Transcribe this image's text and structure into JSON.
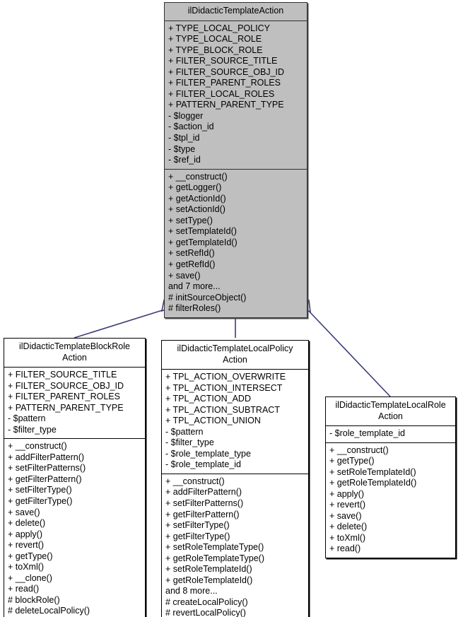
{
  "diagram": {
    "type": "uml-class-inheritance",
    "relationship": "generalization",
    "edge_color": "#3b3b7a"
  },
  "classes": {
    "base": {
      "name": "ilDidacticTemplateAction",
      "title_lines": "ilDidacticTemplateAction",
      "attributes": [
        "+ TYPE_LOCAL_POLICY",
        "+ TYPE_LOCAL_ROLE",
        "+ TYPE_BLOCK_ROLE",
        "+ FILTER_SOURCE_TITLE",
        "+ FILTER_SOURCE_OBJ_ID",
        "+ FILTER_PARENT_ROLES",
        "+ FILTER_LOCAL_ROLES",
        "+ PATTERN_PARENT_TYPE",
        "- $logger",
        "- $action_id",
        "- $tpl_id",
        "- $type",
        "- $ref_id"
      ],
      "operations": [
        "+ __construct()",
        "+ getLogger()",
        "+ getActionId()",
        "+ setActionId()",
        "+ setType()",
        "+ setTemplateId()",
        "+ getTemplateId()",
        "+ setRefId()",
        "+ getRefId()",
        "+ save()",
        "and 7 more...",
        "# initSourceObject()",
        "# filterRoles()"
      ]
    },
    "block_role": {
      "name": "ilDidacticTemplateBlockRoleAction",
      "title_lines": "ilDidacticTemplateBlockRole\nAction",
      "attributes": [
        "+ FILTER_SOURCE_TITLE",
        "+ FILTER_SOURCE_OBJ_ID",
        "+ FILTER_PARENT_ROLES",
        "+ PATTERN_PARENT_TYPE",
        "- $pattern",
        "- $filter_type"
      ],
      "operations": [
        "+ __construct()",
        "+ addFilterPattern()",
        "+ setFilterPatterns()",
        "+ getFilterPattern()",
        "+ setFilterType()",
        "+ getFilterType()",
        "+ save()",
        "+ delete()",
        "+ apply()",
        "+ revert()",
        "+ getType()",
        "+ toXml()",
        "+ __clone()",
        "+ read()",
        "# blockRole()",
        "# deleteLocalPolicy()"
      ]
    },
    "local_policy": {
      "name": "ilDidacticTemplateLocalPolicyAction",
      "title_lines": "ilDidacticTemplateLocalPolicy\nAction",
      "attributes": [
        "+ TPL_ACTION_OVERWRITE",
        "+ TPL_ACTION_INTERSECT",
        "+ TPL_ACTION_ADD",
        "+ TPL_ACTION_SUBTRACT",
        "+ TPL_ACTION_UNION",
        "- $pattern",
        "- $filter_type",
        "- $role_template_type",
        "- $role_template_id"
      ],
      "operations": [
        "+ __construct()",
        "+ addFilterPattern()",
        "+ setFilterPatterns()",
        "+ getFilterPattern()",
        "+ setFilterType()",
        "+ getFilterType()",
        "+ setRoleTemplateType()",
        "+ getRoleTemplateType()",
        "+ setRoleTemplateId()",
        "+ getRoleTemplateId()",
        "and 8 more...",
        "# createLocalPolicy()",
        "# revertLocalPolicy()"
      ]
    },
    "local_role": {
      "name": "ilDidacticTemplateLocalRoleAction",
      "title_lines": "ilDidacticTemplateLocalRole\nAction",
      "attributes": [
        "- $role_template_id"
      ],
      "operations": [
        "+ __construct()",
        "+ getType()",
        "+ setRoleTemplateId()",
        "+ getRoleTemplateId()",
        "+ apply()",
        "+ revert()",
        "+ save()",
        "+ delete()",
        "+ toXml()",
        "+ read()"
      ]
    }
  }
}
